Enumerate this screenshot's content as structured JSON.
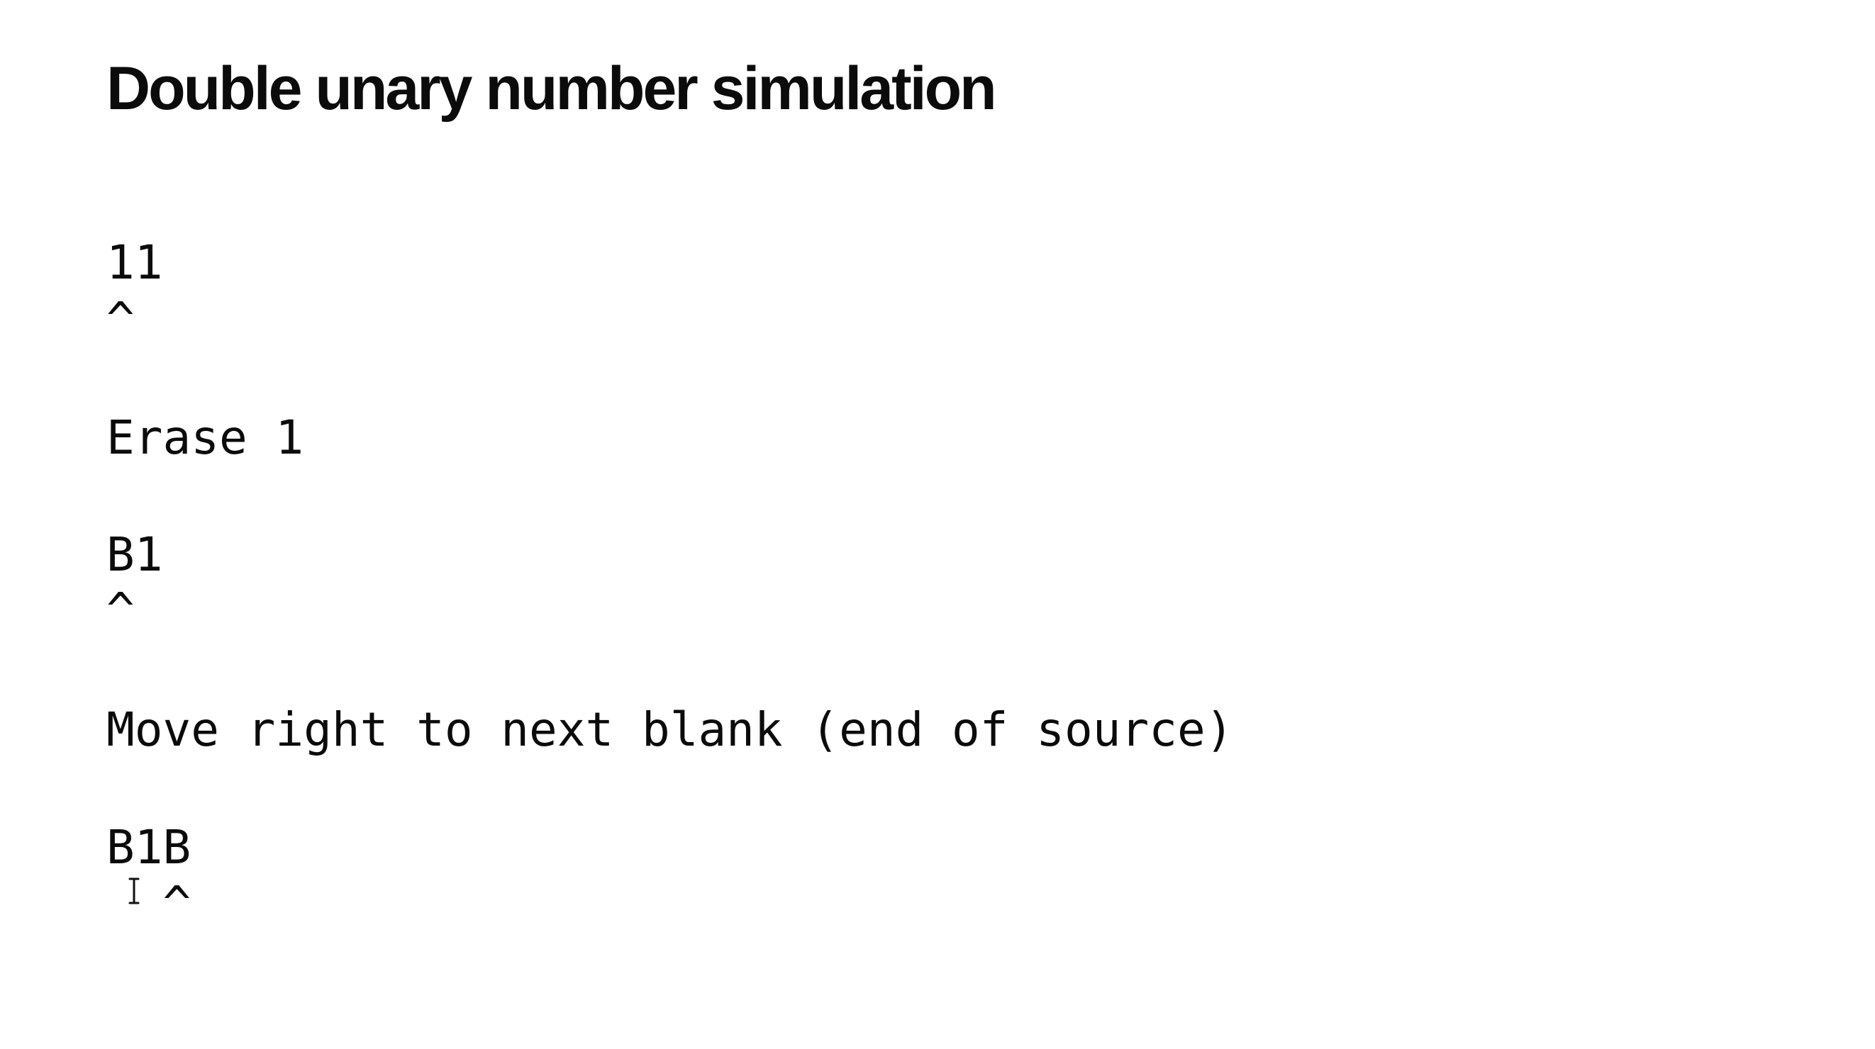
{
  "slide": {
    "title": "Double unary number simulation",
    "lines": [
      "11",
      "^",
      "Erase 1",
      "B1",
      "^",
      "Move right to next blank (end of source)",
      "B1B",
      "  ^"
    ]
  },
  "icons": {
    "cursor": "text-cursor-icon"
  }
}
